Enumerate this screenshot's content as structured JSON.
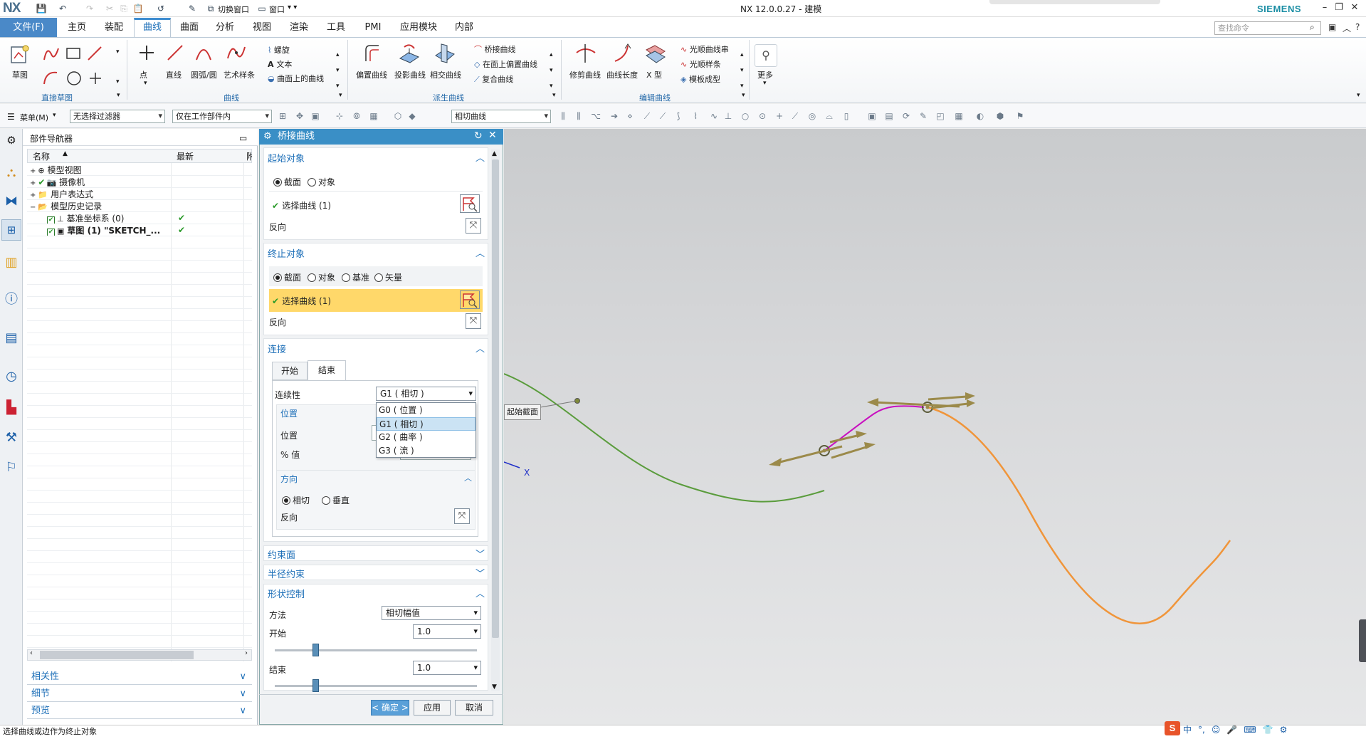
{
  "titlebar": {
    "logo": "NX",
    "title": "NX 12.0.0.27 - 建模",
    "brand": "SIEMENS",
    "switch_window": "切换窗口",
    "window_menu": "窗口"
  },
  "menu": {
    "file": "文件(F)",
    "tabs": [
      "主页",
      "装配",
      "曲线",
      "曲面",
      "分析",
      "视图",
      "渲染",
      "工具",
      "PMI",
      "应用模块",
      "内部"
    ],
    "active_tab": "曲线",
    "search_placeholder": "查找命令"
  },
  "ribbon": {
    "groups": [
      "直接草图",
      "曲线",
      "派生曲线",
      "编辑曲线"
    ],
    "sketch": "草图",
    "curve_buttons": [
      "点",
      "直线",
      "圆弧/圆",
      "艺术样条"
    ],
    "curve_small": [
      "螺旋",
      "文本",
      "曲面上的曲线"
    ],
    "derived_buttons": [
      "偏置曲线",
      "投影曲线",
      "相交曲线"
    ],
    "derived_small": [
      "桥接曲线",
      "在面上偏置曲线",
      "复合曲线"
    ],
    "edit_buttons": [
      "修剪曲线",
      "曲线长度",
      "X 型"
    ],
    "edit_small": [
      "光顺曲线串",
      "光顺样条",
      "模板成型"
    ],
    "more": "更多"
  },
  "toolbar2": {
    "menu": "菜单(M)",
    "filter": "无选择过滤器",
    "scope": "仅在工作部件内",
    "curve_rule": "相切曲线"
  },
  "navigator": {
    "title": "部件导航器",
    "col_name": "名称",
    "col_latest": "最新",
    "col_attached": "附",
    "rows": [
      {
        "label": "模型视图",
        "check": ""
      },
      {
        "label": "摄像机",
        "check": ""
      },
      {
        "label": "用户表达式",
        "check": ""
      },
      {
        "label": "模型历史记录",
        "check": ""
      },
      {
        "label": "基准坐标系 (0)",
        "check": "✔"
      },
      {
        "label": "草图 (1) \"SKETCH_...",
        "check": "✔"
      }
    ],
    "panels": [
      "相关性",
      "细节",
      "预览"
    ]
  },
  "dialog": {
    "title": "桥接曲线",
    "start": {
      "header": "起始对象",
      "options": [
        "截面",
        "对象"
      ],
      "selected": "截面",
      "select": "选择曲线 (1)",
      "reverse": "反向"
    },
    "end": {
      "header": "终止对象",
      "options": [
        "截面",
        "对象",
        "基准",
        "矢量"
      ],
      "selected": "截面",
      "select": "选择曲线 (1)",
      "reverse": "反向"
    },
    "connect": {
      "header": "连接",
      "tabs": [
        "开始",
        "结束"
      ],
      "active_tab": "结束",
      "continuity_label": "连续性",
      "continuity_value": "G1 ( 相切 )",
      "continuity_options": [
        "G0 ( 位置 )",
        "G1 ( 相切 )",
        "G2 ( 曲率 )",
        "G3 ( 流 )"
      ],
      "position_header": "位置",
      "position_label": "位置",
      "percent_label": "% 值",
      "direction_header": "方向",
      "direction_options": [
        "相切",
        "垂直"
      ],
      "direction_selected": "相切",
      "reverse": "反向"
    },
    "collapsed": [
      "约束面",
      "半径约束"
    ],
    "shape": {
      "header": "形状控制",
      "method_label": "方法",
      "method_value": "相切幅值",
      "start_label": "开始",
      "start_value": "1.0",
      "start_slider": 0.2,
      "end_label": "结束",
      "end_value": "1.0",
      "end_slider": 0.2
    },
    "buttons": {
      "ok": "< 确定 >",
      "apply": "应用",
      "cancel": "取消"
    }
  },
  "viewport": {
    "label_start_section": "起始截面",
    "axis_x": "X",
    "colors": {
      "start_curve": "#5a9c3c",
      "bridge": "#c80fbf",
      "end_curve": "#f0953a",
      "arrow": "#9b8a4a"
    }
  },
  "status": {
    "message": "选择曲线或边作为终止对象"
  },
  "ime": [
    "中",
    "°,",
    "☺",
    "🎤",
    "⌨",
    "👕",
    "⚙"
  ]
}
